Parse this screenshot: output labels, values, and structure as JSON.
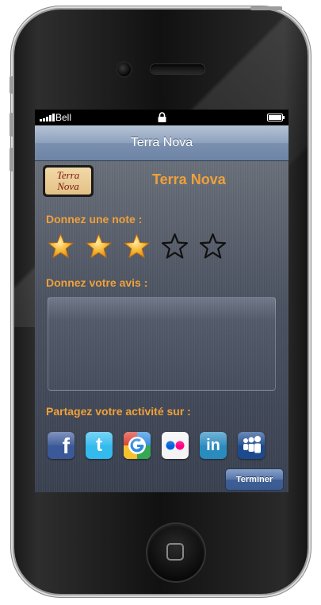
{
  "status_bar": {
    "carrier": "Bell",
    "signal_bars": 5
  },
  "nav_bar": {
    "title": "Terra Nova"
  },
  "header": {
    "logo_text_line1": "Terra",
    "logo_text_line2": "Nova",
    "title": "Terra Nova"
  },
  "rating": {
    "label": "Donnez une note :",
    "value": 3,
    "max": 5
  },
  "review": {
    "label": "Donnez votre avis :",
    "value": ""
  },
  "share": {
    "label": "Partagez votre activité sur :",
    "icons": [
      "facebook-icon",
      "twitter-icon",
      "google-icon",
      "flickr-icon",
      "linkedin-icon",
      "myspace-icon"
    ]
  },
  "actions": {
    "done_label": "Terminer"
  },
  "colors": {
    "accent": "#f0a13a",
    "navbar": "#7b90af",
    "button": "#3e5e95"
  }
}
